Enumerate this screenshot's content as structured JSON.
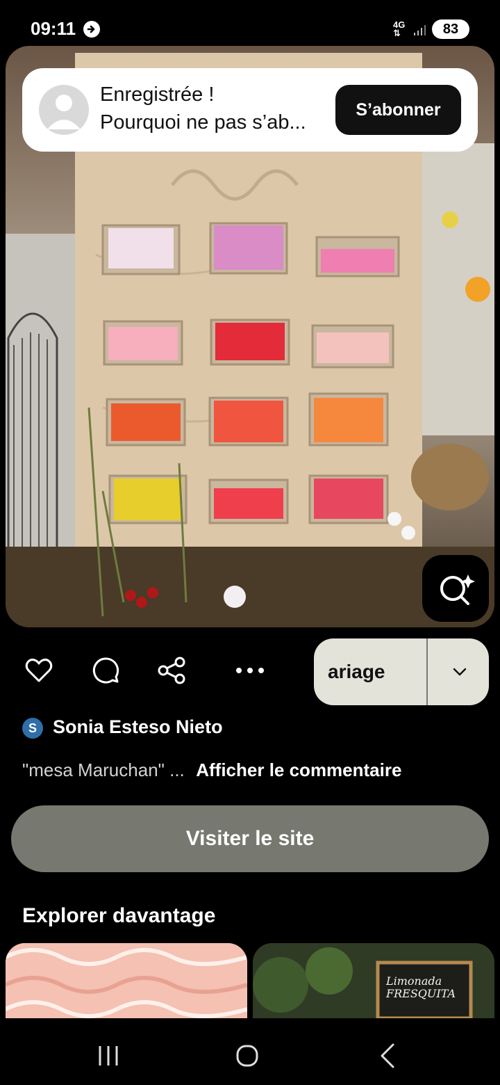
{
  "status_bar": {
    "time": "09:11",
    "network": "4G",
    "battery": "83"
  },
  "toast": {
    "title": "Enregistrée !",
    "message": "Pourquoi ne pas s’ab...",
    "button": "S’abonner"
  },
  "board": {
    "name": "ariage"
  },
  "author": {
    "initial": "S",
    "name": "Sonia Esteso Nieto"
  },
  "comment": {
    "text": "\"mesa Maruchan\" ...",
    "link": "Afficher le commentaire"
  },
  "visit_button": "Visiter le site",
  "explore": {
    "title": "Explorer davantage",
    "thumb_text": "Limonada FRESQUITA"
  },
  "colors": {
    "board_bg": "#e3e3da",
    "visit_bg": "#77786f",
    "avatar_blue": "#2f6ea8"
  },
  "icons": [
    "heart-icon",
    "comment-icon",
    "share-icon",
    "more-icon",
    "visual-search-icon",
    "chevron-down-icon",
    "recent-apps-icon",
    "home-icon",
    "back-icon"
  ]
}
